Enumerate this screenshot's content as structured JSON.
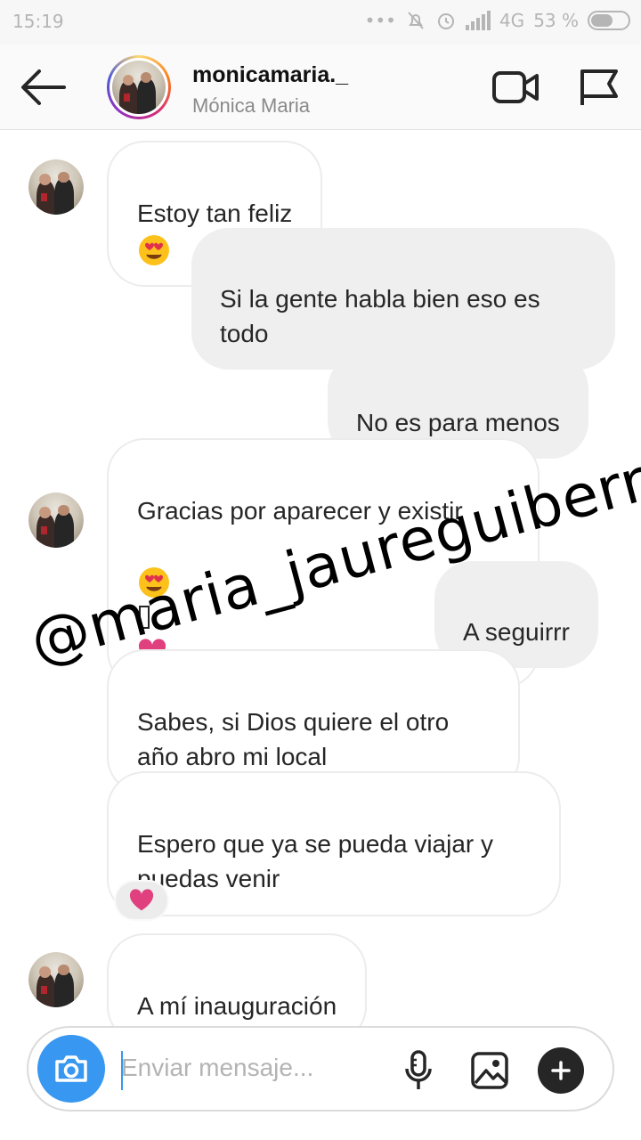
{
  "status_bar": {
    "time": "15:19",
    "network": "4G",
    "battery": "53 %"
  },
  "header": {
    "username": "monicamaria._",
    "full_name": "Mónica Maria"
  },
  "messages": [
    {
      "side": "in",
      "text": "Estoy tan feliz"
    },
    {
      "side": "out",
      "text": "Si la gente habla bien eso es\ntodo"
    },
    {
      "side": "out",
      "text": "No es para menos"
    },
    {
      "side": "in",
      "text": "Gracias por aparecer y existir"
    },
    {
      "side": "out",
      "text": "A seguirrr"
    },
    {
      "side": "in",
      "text": "Sabes, si Dios quiere el otro\naño abro mi local"
    },
    {
      "side": "in",
      "text": "Espero que ya se pueda viajar y\npuedas venir"
    },
    {
      "side": "in",
      "text": "A mí inauguración"
    }
  ],
  "watermark": "@maria_jaureguiberry",
  "composer": {
    "placeholder": "Enviar mensaje..."
  },
  "colors": {
    "accent": "#3897f0",
    "heart": "#e0407e",
    "bubble_out": "#efefef"
  }
}
